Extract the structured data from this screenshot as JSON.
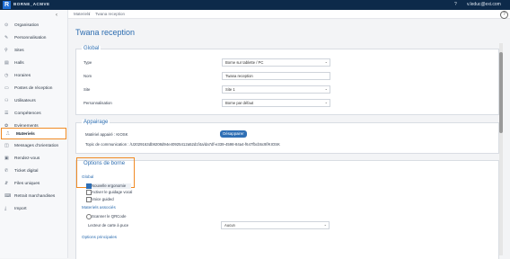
{
  "topbar": {
    "brand": "BORNE_ACMVE",
    "help_icon": "?",
    "user": "v.leduc@exi.com"
  },
  "sidebar": {
    "items": [
      {
        "icon": "⊙",
        "label": "Organisation"
      },
      {
        "icon": "✎",
        "label": "Personnalisation"
      },
      {
        "icon": "⚲",
        "label": "Sites"
      },
      {
        "icon": "▤",
        "label": "Halls"
      },
      {
        "icon": "◷",
        "label": "Horaires"
      },
      {
        "icon": "▭",
        "label": "Postes de réception"
      },
      {
        "icon": "⚇",
        "label": "Utilisateurs"
      },
      {
        "icon": "☰",
        "label": "Compétences"
      },
      {
        "icon": "✿",
        "label": "Evènements"
      },
      {
        "icon": "⎍",
        "label": "Materiels"
      },
      {
        "icon": "◫",
        "label": "Messages d'orientation"
      },
      {
        "icon": "▣",
        "label": "Rendez-vous"
      },
      {
        "icon": "✆",
        "label": "Ticket digital"
      },
      {
        "icon": "⇵",
        "label": "Files uniques"
      },
      {
        "icon": "⌨",
        "label": "Retrait marchandises"
      },
      {
        "icon": "⤓",
        "label": "Import"
      }
    ]
  },
  "breadcrumb": {
    "parent": "Materiels",
    "separator": "/",
    "current": "Twana reception"
  },
  "page": {
    "title": "Twana reception"
  },
  "global": {
    "title": "Global",
    "fields": [
      {
        "label": "Type",
        "value": "Borne sur tablette / PC"
      },
      {
        "label": "Nom",
        "value": "Twana reception"
      },
      {
        "label": "Site",
        "value": "Site 1"
      },
      {
        "label": "Personnalisation",
        "value": "Borne par défaut"
      }
    ]
  },
  "appairage": {
    "title": "Appairage",
    "device_label": "Matériel appairé : KIOSK",
    "topic": "Topic de communication : /U2029163db9208d94e40925412a52d1f4a/da7df-e339-4598-84a4-f647fbcb5c9f/KIOSK",
    "button": "Désappairer"
  },
  "options": {
    "title": "Options de borne",
    "global_sub": "Global",
    "checkboxes": [
      {
        "label": "Nouvelle ergonomie",
        "checked": true
      },
      {
        "label": "Activer le guidage vocal",
        "checked": false
      },
      {
        "label": "Voice guided",
        "checked": false
      }
    ],
    "materials_sub": "Materiels associés",
    "radio_label": "Scanner le QRCode",
    "card_reader_label": "Lecteur de carte à puce",
    "card_reader_value": "Aucun",
    "principal_sub": "Options principales"
  }
}
